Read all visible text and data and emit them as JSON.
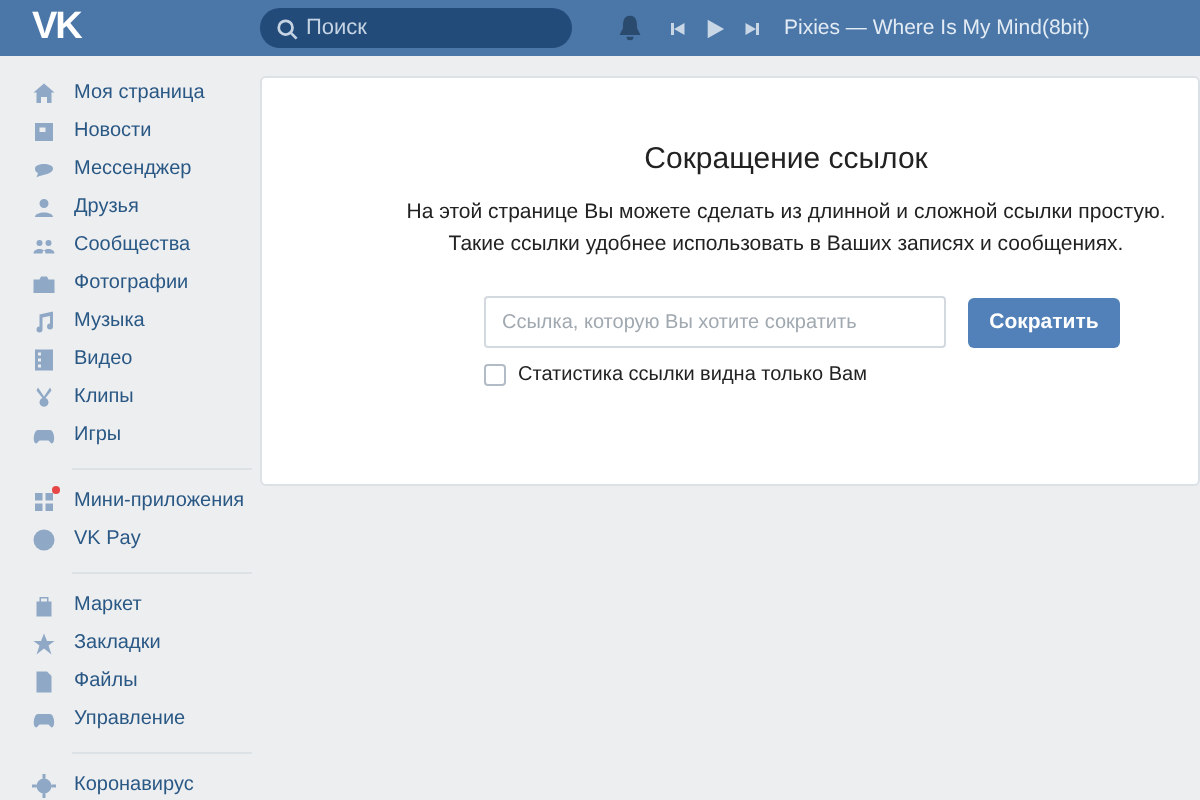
{
  "header": {
    "logo": "VK",
    "search": {
      "placeholder": "Поиск"
    },
    "player": {
      "track": "Pixies — Where Is My Mind(8bit)"
    }
  },
  "sidebar": {
    "groups": [
      {
        "items": [
          {
            "label": "Моя страница",
            "notification": false
          },
          {
            "label": "Новости",
            "notification": false
          },
          {
            "label": "Мессенджер",
            "notification": false
          },
          {
            "label": "Друзья",
            "notification": false
          },
          {
            "label": "Сообщества",
            "notification": false
          },
          {
            "label": "Фотографии",
            "notification": false
          },
          {
            "label": "Музыка",
            "notification": false
          },
          {
            "label": "Видео",
            "notification": false
          },
          {
            "label": "Клипы",
            "notification": false
          },
          {
            "label": "Игры",
            "notification": false
          }
        ]
      },
      {
        "items": [
          {
            "label": "Мини-приложения",
            "notification": true
          },
          {
            "label": "VK Pay",
            "notification": false
          }
        ]
      },
      {
        "items": [
          {
            "label": "Маркет",
            "notification": false
          },
          {
            "label": "Закладки",
            "notification": false
          },
          {
            "label": "Файлы",
            "notification": false
          },
          {
            "label": "Управление",
            "notification": false
          }
        ]
      },
      {
        "items": [
          {
            "label": "Коронавирус",
            "notification": false
          }
        ]
      }
    ]
  },
  "content": {
    "title": "Сокращение ссылок",
    "description": [
      "На этой странице Вы можете сделать из длинной и сложной ссылки простую.",
      "Такие ссылки удобнее использовать в Ваших записях и сообщениях."
    ],
    "link_field": {
      "placeholder": "Ссылка, которую Вы хотите сократить"
    },
    "submit_button": "Сократить",
    "private_stats": {
      "label": "Статистика ссылки видна только Вам",
      "checked": false
    }
  }
}
